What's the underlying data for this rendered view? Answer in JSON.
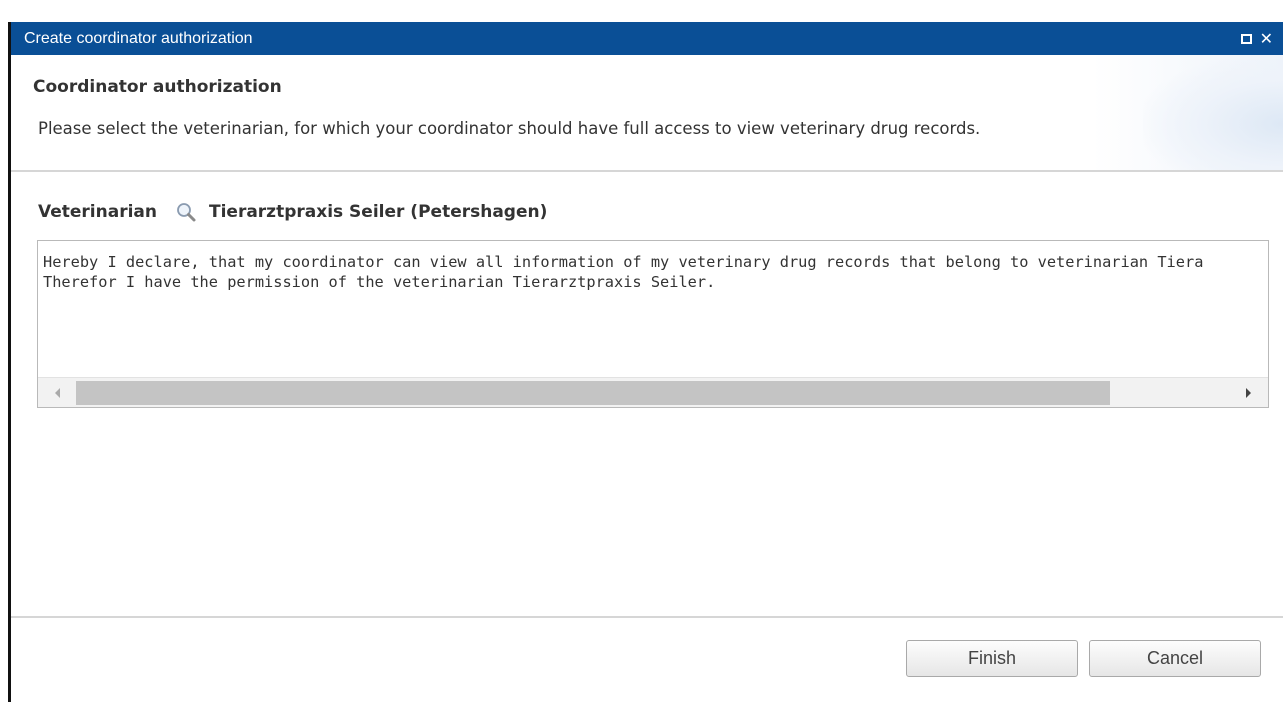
{
  "window": {
    "title": "Create coordinator authorization",
    "maximize_icon": "maximize-icon",
    "close_glyph": "✕"
  },
  "header": {
    "title": "Coordinator authorization",
    "description": "Please select the veterinarian, for which your coordinator should have full access to view veterinary drug records."
  },
  "veterinarian": {
    "label": "Veterinarian",
    "icon": "search-icon",
    "value": "Tierarztpraxis Seiler (Petershagen)"
  },
  "declaration": {
    "line1": "Hereby I declare, that my coordinator can view all information of my veterinary drug records that belong to veterinarian Tiera",
    "line2": "Therefor I have the permission of the veterinarian Tierarztpraxis Seiler."
  },
  "buttons": {
    "finish": "Finish",
    "cancel": "Cancel"
  },
  "colors": {
    "titlebar": "#0a4f96",
    "scroll_thumb": "#c4c4c4"
  }
}
